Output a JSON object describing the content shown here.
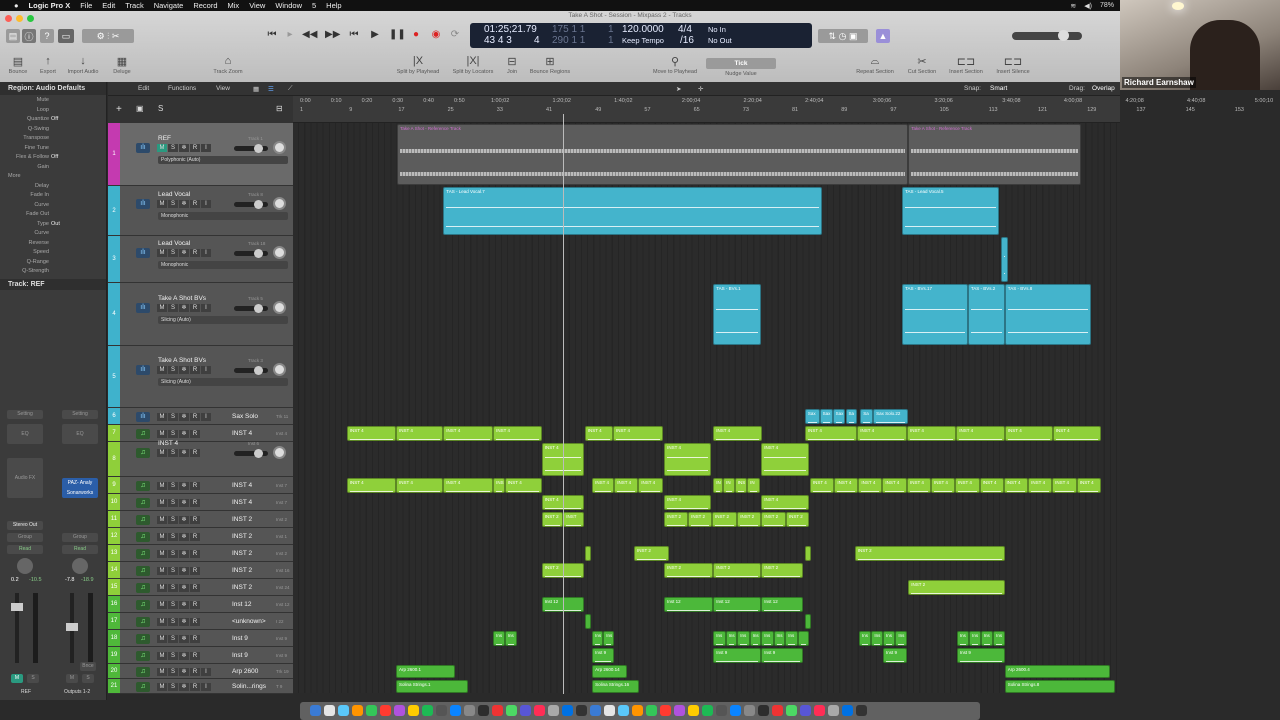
{
  "menubar": {
    "app": "Logic Pro X",
    "items": [
      "File",
      "Edit",
      "Track",
      "Navigate",
      "Record",
      "Mix",
      "View",
      "Window",
      "5",
      "Help"
    ],
    "battery": "78%"
  },
  "window_title": "Take A Shot - Session - Mixpass 2 - Tracks",
  "lcd": {
    "time": "01:25;21.79",
    "bars": "43 4 3",
    "div": "4",
    "loc_start": "175 1 1",
    "loc_start_t": "1",
    "loc_end": "290 1 1",
    "loc_end_t": "1",
    "tempo": "120.0000",
    "tempo_mode": "Keep Tempo",
    "sig": "4/4",
    "division": "/16",
    "in": "No In",
    "out": "No Out"
  },
  "toolbar": {
    "bounce": "Bounce",
    "export": "Export",
    "import": "Import Audio",
    "deluge": "Deluge",
    "track_zoom": "Track Zoom",
    "split_playhead": "Split by Playhead",
    "split_locators": "Split by Locators",
    "join": "Join",
    "bounce_regions": "Bounce Regions",
    "move_playhead": "Move to Playhead",
    "nudge_value": "Nudge Value",
    "nudge": "Tick",
    "repeat": "Repeat Section",
    "cut": "Cut Section",
    "insert": "Insert Section",
    "silence": "Insert Silence"
  },
  "webcam": {
    "name": "Richard Earnshaw"
  },
  "inspector": {
    "region_header": "Region: Audio Defaults",
    "params": [
      [
        "Mute",
        ""
      ],
      [
        "Loop",
        ""
      ],
      [
        "Quantize",
        "Off"
      ],
      [
        "Q-Swing",
        ""
      ],
      [
        "Transpose",
        ""
      ],
      [
        "Fine Tune",
        ""
      ],
      [
        "Flex & Follow",
        "Off"
      ],
      [
        "Gain",
        ""
      ],
      [
        "More",
        ""
      ],
      [
        "Delay",
        ""
      ],
      [
        "Fade In",
        ""
      ],
      [
        "Curve",
        ""
      ],
      [
        "Fade Out",
        ""
      ],
      [
        "Type",
        "Out"
      ],
      [
        "Curve",
        ""
      ],
      [
        "Reverse",
        ""
      ],
      [
        "Speed",
        ""
      ],
      [
        "Q-Range",
        ""
      ],
      [
        "Q-Strength",
        ""
      ]
    ],
    "track_header": "Track: REF",
    "strip1": {
      "setting": "Setting",
      "eq": "EQ",
      "fx": "Audio FX",
      "out": "Stereo Out",
      "group": "Group",
      "auto": "Read",
      "vol": "0.2",
      "peak": "-10.5",
      "name": "REF",
      "m": "M",
      "s": "S"
    },
    "strip2": {
      "setting": "Setting",
      "eq": "EQ",
      "plugin": "PAZ- Analy Sonarworks",
      "group": "Group",
      "auto": "Read",
      "vol": "-7.8",
      "peak": "-18.9",
      "bnce": "Bnce",
      "name": "Outputs 1-2",
      "m": "M",
      "s": "S"
    }
  },
  "arrange": {
    "edit": "Edit",
    "functions": "Functions",
    "view": "View",
    "snap_label": "Snap:",
    "snap": "Smart",
    "drag_label": "Drag:",
    "drag": "Overlap"
  },
  "ruler": {
    "times": [
      "0:00",
      "0:10",
      "0:20",
      "0:30",
      "0:40",
      "0:50",
      "1:00;02",
      "1:20;02",
      "1:40;02",
      "2:00;04",
      "2:20;04",
      "2:40;04",
      "3:00;06",
      "3:20;06",
      "3:40;08",
      "4:00;08",
      "4:20;08",
      "4:40;08",
      "5:00;10"
    ],
    "bars": [
      1,
      9,
      17,
      25,
      33,
      41,
      49,
      57,
      65,
      73,
      81,
      89,
      97,
      105,
      113,
      121,
      129,
      137,
      145,
      153
    ],
    "playhead_bar": 43.8
  },
  "tracks": [
    {
      "n": 1,
      "name": "REF",
      "type": "audio",
      "mode": "Polyphonic (Auto)",
      "tag": "Track 1",
      "color": "#c43ab0",
      "big": true
    },
    {
      "n": 2,
      "name": "Lead Vocal",
      "type": "audio",
      "mode": "Monophonic",
      "tag": "Track 8",
      "color": "#3fb2cc",
      "big": true
    },
    {
      "n": 3,
      "name": "Lead Vocal",
      "type": "audio",
      "mode": "Monophonic",
      "tag": "Track 18",
      "color": "#3fb2cc",
      "big": true
    },
    {
      "n": 4,
      "name": "Take A Shot BVs",
      "type": "audio",
      "mode": "Slicing (Auto)",
      "tag": "Track 5",
      "color": "#3fb2cc",
      "big": true
    },
    {
      "n": 5,
      "name": "Take A Shot BVs",
      "type": "audio",
      "mode": "Slicing (Auto)",
      "tag": "Track 3",
      "color": "#3fb2cc",
      "big": true
    },
    {
      "n": 6,
      "name": "Sax Solo",
      "type": "audio",
      "tag": "Trk 11",
      "color": "#3fb2cc"
    },
    {
      "n": 7,
      "name": "INST 4",
      "type": "inst",
      "tag": "Inst 4",
      "color": "#8fcf3a"
    },
    {
      "n": 8,
      "name": "INST 4",
      "type": "inst",
      "tag": "Inst 6",
      "color": "#8fcf3a",
      "big": true
    },
    {
      "n": 9,
      "name": "INST 4",
      "type": "inst",
      "tag": "Inst 7",
      "color": "#8fcf3a"
    },
    {
      "n": 10,
      "name": "INST 4",
      "type": "inst",
      "tag": "Inst 7",
      "color": "#8fcf3a"
    },
    {
      "n": 11,
      "name": "INST 2",
      "type": "inst",
      "tag": "Inst 2",
      "color": "#8fcf3a"
    },
    {
      "n": 12,
      "name": "INST 2",
      "type": "inst",
      "tag": "Inst 1",
      "color": "#8fcf3a"
    },
    {
      "n": 13,
      "name": "INST 2",
      "type": "inst",
      "tag": "Inst 2",
      "color": "#8fcf3a"
    },
    {
      "n": 14,
      "name": "INST 2",
      "type": "inst",
      "tag": "Inst 16",
      "color": "#8fcf3a"
    },
    {
      "n": 15,
      "name": "INST 2",
      "type": "inst",
      "tag": "Inst 24",
      "color": "#8fcf3a"
    },
    {
      "n": 16,
      "name": "Inst 12",
      "type": "inst",
      "tag": "Inst 12",
      "color": "#4fb83a"
    },
    {
      "n": 17,
      "name": "<unknown>",
      "type": "inst",
      "tag": "I 22",
      "color": "#4fb83a"
    },
    {
      "n": 18,
      "name": "Inst 9",
      "type": "inst",
      "tag": "Inst 9",
      "color": "#4fb83a"
    },
    {
      "n": 19,
      "name": "Inst 9",
      "type": "inst",
      "tag": "Inst 9",
      "color": "#4fb83a"
    },
    {
      "n": 20,
      "name": "Arp 2600",
      "type": "inst",
      "tag": "Trk 19",
      "color": "#4fb83a",
      "io": true
    },
    {
      "n": 21,
      "name": "Solin...rings",
      "type": "inst",
      "tag": "T 9",
      "color": "#4fb83a",
      "io": true
    }
  ],
  "button_labels": {
    "m": "M",
    "s": "S",
    "f": "❄",
    "r": "R",
    "i": "I"
  },
  "regions": [
    [
      1,
      16.8,
      99.9,
      "Take A Shot - Reference Track"
    ],
    [
      1,
      99.9,
      128,
      "Take A Shot - Reference Track"
    ],
    [
      2,
      24.3,
      85.9,
      "TAS - Lead Vocal.7"
    ],
    [
      2,
      98.9,
      114.7,
      "TAS - Lead Vocal.5"
    ],
    [
      3,
      115,
      116.1,
      ""
    ],
    [
      4,
      68.2,
      76,
      "TAS - BVs.1"
    ],
    [
      4,
      98.9,
      109.6,
      "TAS - BVs.17"
    ],
    [
      4,
      109.6,
      115.6,
      "TAS - BVs.2"
    ],
    [
      4,
      115.6,
      129.6,
      "TAS - BVs.8"
    ],
    [
      6,
      83.1,
      85.5,
      "Sax"
    ],
    [
      6,
      85.5,
      87.6,
      "Sax"
    ],
    [
      6,
      87.6,
      89.7,
      "Sax"
    ],
    [
      6,
      89.7,
      91.6,
      "Sa"
    ],
    [
      6,
      92.1,
      94.2,
      "Sa"
    ],
    [
      6,
      94.2,
      99.9,
      "Sax Solo.22"
    ],
    [
      7,
      8.6,
      16.6,
      "INST 4"
    ],
    [
      7,
      16.6,
      24.3,
      "INST 4"
    ],
    [
      7,
      24.3,
      32.4,
      "INST 4"
    ],
    [
      7,
      32.4,
      40.3,
      "INST 4"
    ],
    [
      7,
      47.3,
      51.9,
      "INST 4"
    ],
    [
      7,
      51.9,
      60,
      "INST 4"
    ],
    [
      7,
      68.2,
      76.1,
      "INST 4"
    ],
    [
      7,
      83.1,
      91.6,
      "INST 4"
    ],
    [
      7,
      91.6,
      99.7,
      "INST 4"
    ],
    [
      7,
      99.7,
      107.7,
      "INST 4"
    ],
    [
      7,
      107.7,
      115.6,
      "INST 4"
    ],
    [
      7,
      115.6,
      123.4,
      "INST 4"
    ],
    [
      7,
      123.4,
      131.2,
      "INST 4"
    ],
    [
      8,
      40.3,
      47.2,
      "INST 4"
    ],
    [
      8,
      60.2,
      67.8,
      "INST 4"
    ],
    [
      8,
      76,
      83.8,
      "INST 4"
    ],
    [
      9,
      8.6,
      16.6,
      "INST 4"
    ],
    [
      9,
      16.6,
      24.3,
      "INST 4"
    ],
    [
      9,
      24.3,
      32.4,
      "INST 4"
    ],
    [
      9,
      32.4,
      34.3,
      "INS"
    ],
    [
      9,
      34.3,
      40.3,
      "INST 4"
    ],
    [
      9,
      48.5,
      52.1,
      "INST 4"
    ],
    [
      9,
      52.1,
      56,
      "INST 4"
    ],
    [
      9,
      56,
      60,
      "INST 4"
    ],
    [
      9,
      68.2,
      69.8,
      "IN"
    ],
    [
      9,
      69.8,
      71.7,
      "IN"
    ],
    [
      9,
      71.7,
      73.7,
      "INS"
    ],
    [
      9,
      73.7,
      75.8,
      "IN"
    ],
    [
      9,
      83.9,
      87.9,
      "INST 4"
    ],
    [
      9,
      87.9,
      91.8,
      "INST 4"
    ],
    [
      9,
      91.8,
      95.7,
      "INST 4"
    ],
    [
      9,
      95.7,
      99.7,
      "INST 4"
    ],
    [
      9,
      99.7,
      103.6,
      "INST 4"
    ],
    [
      9,
      103.6,
      107.5,
      "INST 4"
    ],
    [
      9,
      107.5,
      111.5,
      "INST 4"
    ],
    [
      9,
      111.5,
      115.4,
      "INST 4"
    ],
    [
      9,
      115.4,
      119.4,
      "INST 4"
    ],
    [
      9,
      119.4,
      123.3,
      "INST 4"
    ],
    [
      9,
      123.3,
      127.3,
      "INST 4"
    ],
    [
      9,
      127.3,
      131.2,
      "INST 4"
    ],
    [
      10,
      40.3,
      47.2,
      "INST 4"
    ],
    [
      10,
      60.2,
      67.8,
      "INST 4"
    ],
    [
      10,
      76,
      83.8,
      "INST 4"
    ],
    [
      11,
      40.3,
      43.8,
      "INST 2"
    ],
    [
      11,
      43.8,
      47.2,
      "INST"
    ],
    [
      11,
      60.2,
      64.1,
      "INST 2"
    ],
    [
      11,
      64.1,
      68,
      "INST 2"
    ],
    [
      11,
      68,
      72.1,
      "INST 2"
    ],
    [
      11,
      72.1,
      76,
      "INST 2"
    ],
    [
      11,
      76,
      80,
      "INST 2"
    ],
    [
      11,
      80,
      83.8,
      "INST 2"
    ],
    [
      13,
      47.3,
      48.2,
      ""
    ],
    [
      13,
      55.3,
      61,
      "INST 2"
    ],
    [
      13,
      83.1,
      83.9,
      ""
    ],
    [
      13,
      91.2,
      115.6,
      "INST 2"
    ],
    [
      14,
      40.3,
      47.2,
      "INST 2"
    ],
    [
      14,
      60.2,
      68.2,
      "INST 2"
    ],
    [
      14,
      68.2,
      76,
      "INST 2"
    ],
    [
      14,
      76,
      82.8,
      "INST 2"
    ],
    [
      15,
      99.9,
      115.6,
      "INST 2"
    ],
    [
      16,
      40.3,
      47.2,
      "Inst 12"
    ],
    [
      16,
      60.2,
      68.2,
      "Inst 12"
    ],
    [
      16,
      68.2,
      76,
      "Inst 12"
    ],
    [
      16,
      76,
      82.8,
      "Inst 12"
    ],
    [
      17,
      47.3,
      48.2,
      ""
    ],
    [
      17,
      83.1,
      83.9,
      ""
    ],
    [
      18,
      32.4,
      34.3,
      "Ins"
    ],
    [
      18,
      34.3,
      36.3,
      "Ins"
    ],
    [
      18,
      48.5,
      50.3,
      "Ins"
    ],
    [
      18,
      50.3,
      52.1,
      "Ins"
    ],
    [
      18,
      68.2,
      70.2,
      "Ins"
    ],
    [
      18,
      70.2,
      72.1,
      "Ins"
    ],
    [
      18,
      72.1,
      74.1,
      "Ins"
    ],
    [
      18,
      74.1,
      76,
      "Ins"
    ],
    [
      18,
      76,
      78,
      "Ins"
    ],
    [
      18,
      78,
      79.9,
      "Ins"
    ],
    [
      18,
      79.9,
      81.9,
      "Ins"
    ],
    [
      18,
      81.9,
      83.8,
      ""
    ],
    [
      18,
      91.9,
      93.9,
      "Ins"
    ],
    [
      18,
      93.9,
      95.8,
      "Ins"
    ],
    [
      18,
      95.8,
      97.8,
      "Ins"
    ],
    [
      18,
      97.8,
      99.7,
      "Ins"
    ],
    [
      18,
      107.8,
      109.8,
      "Ins"
    ],
    [
      18,
      109.8,
      111.7,
      "Ins"
    ],
    [
      18,
      111.7,
      113.7,
      "Ins"
    ],
    [
      18,
      113.7,
      115.6,
      "Ins"
    ],
    [
      19,
      48.5,
      52.1,
      "Inst 9"
    ],
    [
      19,
      68.2,
      76,
      "Inst 9"
    ],
    [
      19,
      76,
      82.8,
      "Inst 9"
    ],
    [
      19,
      95.8,
      99.7,
      "Inst 9"
    ],
    [
      19,
      107.8,
      115.6,
      "Inst 9"
    ],
    [
      20,
      16.6,
      26.2,
      "Arp 2600.1"
    ],
    [
      20,
      48.5,
      54.2,
      "Arp 2600.14"
    ],
    [
      20,
      115.6,
      132.7,
      "Arp 2600.4"
    ],
    [
      21,
      16.6,
      28.3,
      "Solina Strings.1"
    ],
    [
      21,
      48.5,
      56.1,
      "Solina Strings.16"
    ],
    [
      21,
      115.6,
      133.5,
      "Solina Strings.8"
    ]
  ]
}
